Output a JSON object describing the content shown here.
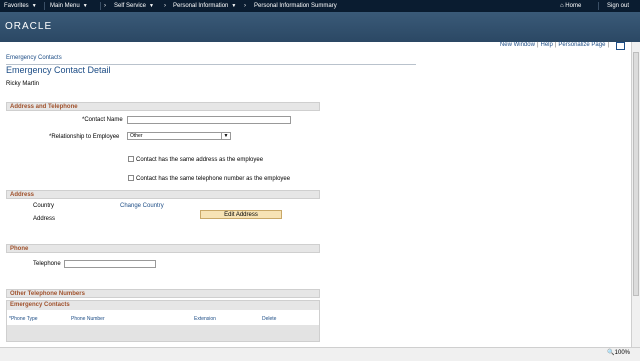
{
  "topnav": {
    "favorites": "Favorites",
    "main_menu": "Main Menu",
    "self_service": "Self Service",
    "personal_info": "Personal Information",
    "summary": "Personal Information Summary",
    "home": "Home",
    "signout": "Sign out"
  },
  "brand": {
    "logo": "ORACLE"
  },
  "links": {
    "new_window": "New Window",
    "help": "Help",
    "personalize": "Personalize Page"
  },
  "page": {
    "breadcrumb": "Emergency Contacts",
    "title": "Emergency Contact Detail",
    "employee": "Ricky Martin"
  },
  "address_tel": {
    "section": "Address and Telephone",
    "contact_name_label": "*Contact Name",
    "contact_name_value": "",
    "relationship_label": "*Relationship to Employee",
    "relationship_value": "Other",
    "same_address": "Contact has the same address as the employee",
    "same_phone": "Contact has the same telephone number as the employee"
  },
  "address": {
    "section": "Address",
    "country_label": "Country",
    "change_country": "Change Country",
    "address_label": "Address",
    "edit_address": "Edit Address"
  },
  "phone": {
    "section": "Phone",
    "telephone_label": "Telephone",
    "telephone_value": ""
  },
  "other_numbers": {
    "section": "Other Telephone Numbers",
    "grid_title": "Emergency Contacts",
    "columns": [
      "*Phone Type",
      "Phone Number",
      "Extension",
      "Delete"
    ]
  },
  "status": {
    "zoom": "100%"
  }
}
